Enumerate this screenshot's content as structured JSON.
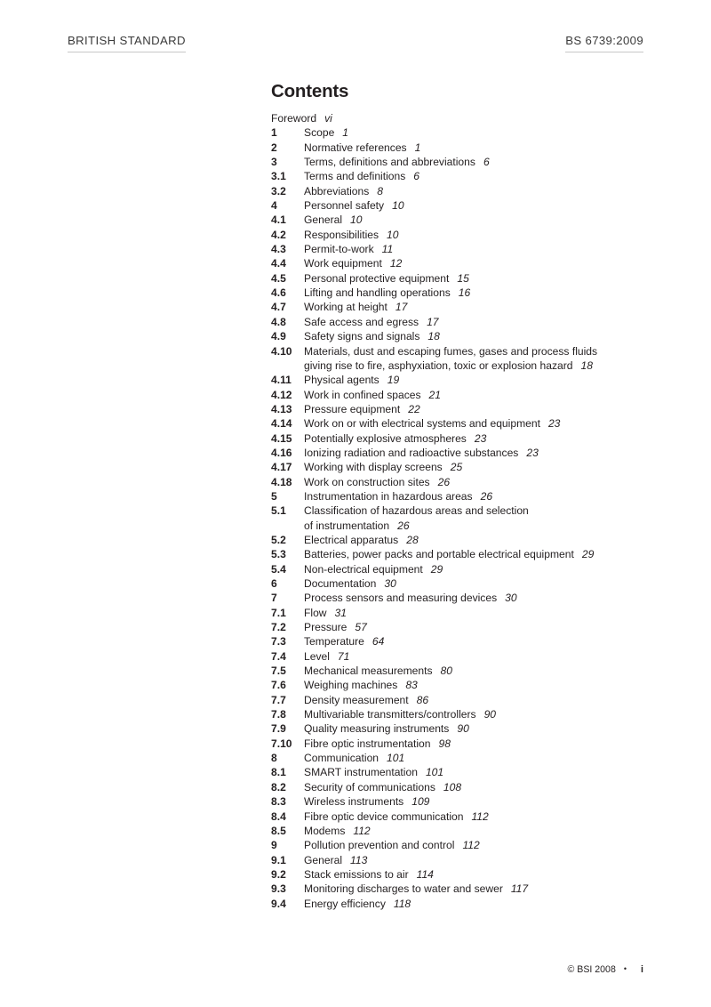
{
  "header": {
    "left_title": "BRITISH STANDARD",
    "right_title": "BS 6739:2009"
  },
  "contents": {
    "heading": "Contents",
    "entries": [
      {
        "number": "",
        "label": "Foreword",
        "page": "vi",
        "foreword": true
      },
      {
        "number": "1",
        "label": "Scope",
        "page": "1"
      },
      {
        "number": "2",
        "label": "Normative references",
        "page": "1"
      },
      {
        "number": "3",
        "label": "Terms, definitions and abbreviations",
        "page": "6"
      },
      {
        "number": "3.1",
        "label": "Terms and definitions",
        "page": "6"
      },
      {
        "number": "3.2",
        "label": "Abbreviations",
        "page": "8"
      },
      {
        "number": "4",
        "label": "Personnel safety",
        "page": "10"
      },
      {
        "number": "4.1",
        "label": "General",
        "page": "10"
      },
      {
        "number": "4.2",
        "label": "Responsibilities",
        "page": "10"
      },
      {
        "number": "4.3",
        "label": "Permit-to-work",
        "page": "11"
      },
      {
        "number": "4.4",
        "label": "Work equipment",
        "page": "12"
      },
      {
        "number": "4.5",
        "label": "Personal protective equipment",
        "page": "15"
      },
      {
        "number": "4.6",
        "label": "Lifting and handling operations",
        "page": "16"
      },
      {
        "number": "4.7",
        "label": "Working at height",
        "page": "17"
      },
      {
        "number": "4.8",
        "label": "Safe access and egress",
        "page": "17"
      },
      {
        "number": "4.9",
        "label": "Safety signs and signals",
        "page": "18"
      },
      {
        "number": "4.10",
        "label": "Materials, dust and escaping fumes, gases and process fluids",
        "label2": "giving rise to fire, asphyxiation, toxic or explosion hazard",
        "page": "18"
      },
      {
        "number": "4.11",
        "label": "Physical agents",
        "page": "19"
      },
      {
        "number": "4.12",
        "label": "Work in confined spaces",
        "page": "21"
      },
      {
        "number": "4.13",
        "label": "Pressure equipment",
        "page": "22"
      },
      {
        "number": "4.14",
        "label": "Work on or with electrical systems and equipment",
        "page": "23"
      },
      {
        "number": "4.15",
        "label": "Potentially explosive atmospheres",
        "page": "23"
      },
      {
        "number": "4.16",
        "label": "Ionizing radiation and radioactive substances",
        "page": "23"
      },
      {
        "number": "4.17",
        "label": "Working with display screens",
        "page": "25"
      },
      {
        "number": "4.18",
        "label": "Work on construction sites",
        "page": "26"
      },
      {
        "number": "5",
        "label": "Instrumentation in hazardous areas",
        "page": "26"
      },
      {
        "number": "5.1",
        "label": "Classification of hazardous areas and selection",
        "label2": "of instrumentation",
        "page": "26"
      },
      {
        "number": "5.2",
        "label": "Electrical apparatus",
        "page": "28"
      },
      {
        "number": "5.3",
        "label": "Batteries, power packs and portable electrical equipment",
        "page": "29"
      },
      {
        "number": "5.4",
        "label": "Non-electrical equipment",
        "page": "29"
      },
      {
        "number": "6",
        "label": "Documentation",
        "page": "30"
      },
      {
        "number": "7",
        "label": "Process sensors and measuring devices",
        "page": "30"
      },
      {
        "number": "7.1",
        "label": "Flow",
        "page": "31"
      },
      {
        "number": "7.2",
        "label": "Pressure",
        "page": "57"
      },
      {
        "number": "7.3",
        "label": "Temperature",
        "page": "64"
      },
      {
        "number": "7.4",
        "label": "Level",
        "page": "71"
      },
      {
        "number": "7.5",
        "label": "Mechanical measurements",
        "page": "80"
      },
      {
        "number": "7.6",
        "label": "Weighing machines",
        "page": "83"
      },
      {
        "number": "7.7",
        "label": "Density measurement",
        "page": "86"
      },
      {
        "number": "7.8",
        "label": "Multivariable transmitters/controllers",
        "page": "90"
      },
      {
        "number": "7.9",
        "label": "Quality measuring instruments",
        "page": "90"
      },
      {
        "number": "7.10",
        "label": "Fibre optic instrumentation",
        "page": "98"
      },
      {
        "number": "8",
        "label": "Communication",
        "page": "101"
      },
      {
        "number": "8.1",
        "label": "SMART instrumentation",
        "page": "101"
      },
      {
        "number": "8.2",
        "label": "Security of communications",
        "page": "108"
      },
      {
        "number": "8.3",
        "label": "Wireless instruments",
        "page": "109"
      },
      {
        "number": "8.4",
        "label": "Fibre optic device communication",
        "page": "112"
      },
      {
        "number": "8.5",
        "label": "Modems",
        "page": "112"
      },
      {
        "number": "9",
        "label": "Pollution prevention and control",
        "page": "112"
      },
      {
        "number": "9.1",
        "label": "General",
        "page": "113"
      },
      {
        "number": "9.2",
        "label": "Stack emissions to air",
        "page": "114"
      },
      {
        "number": "9.3",
        "label": "Monitoring discharges to water and sewer",
        "page": "117"
      },
      {
        "number": "9.4",
        "label": "Energy efficiency",
        "page": "118"
      }
    ]
  },
  "footer": {
    "copyright": "© BSI 2008",
    "separator": "•",
    "folio": "i"
  }
}
